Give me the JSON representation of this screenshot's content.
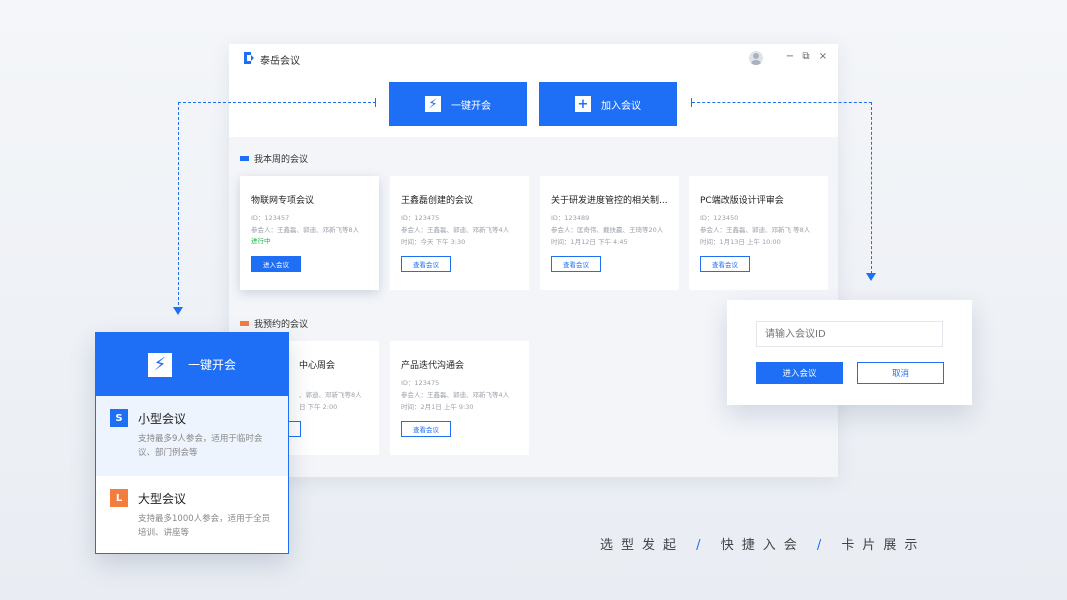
{
  "colors": {
    "accent": "#1e6ff5",
    "orange": "#f47c3c",
    "green": "#19b34c"
  },
  "app": {
    "title": "泰岳会议"
  },
  "window_controls": {
    "minimize": "−",
    "restore": "⧉",
    "close": "×"
  },
  "actions": {
    "quick_start": "一键开会",
    "join": "加入会议",
    "quick_icon": "⚡",
    "join_icon": "+"
  },
  "weekly": {
    "title": "我本周的会议",
    "cards": [
      {
        "title": "物联网专项会议",
        "id": "ID：123457",
        "members": "参会人：王鑫磊、郭迪、邓新飞等8人",
        "status": "进行中",
        "button": "进入会议"
      },
      {
        "title": "王鑫磊创建的会议",
        "id": "ID：123475",
        "members": "参会人：王鑫磊、郭迪、邓新飞等4人",
        "time": "时间：今天 下午 3:30",
        "button": "查看会议"
      },
      {
        "title": "关于研发进度管控的相关制...",
        "id": "ID：123489",
        "members": "参会人：匡奇伟、戴扶赢、王琦等20人",
        "time": "时间：1月12日 下午 4:45",
        "button": "查看会议"
      },
      {
        "title": "PC端改版设计评审会",
        "id": "ID：123450",
        "members": "参会人：王鑫磊、郭迪、邓新飞 等8人",
        "time": "时间：1月13日 上午 10:00",
        "button": "查看会议"
      }
    ]
  },
  "booked": {
    "title": "我预约的会议",
    "cards": [
      {
        "title": "中心周会",
        "members": "、郭迪、邓新飞等8人",
        "time": "日 下午 2:00"
      },
      {
        "title": "产品迭代沟通会",
        "id": "ID：123475",
        "members": "参会人：王鑫磊、郭迪、邓新飞等4人",
        "time": "时间：2月1日 上午 9:30",
        "button": "查看会议"
      }
    ]
  },
  "quick_menu": {
    "head": "一键开会",
    "options": [
      {
        "badge": "S",
        "title": "小型会议",
        "desc": "支持最多9人参会，适用于临时会议、部门例会等"
      },
      {
        "badge": "L",
        "title": "大型会议",
        "desc": "支持最多1000人参会，适用于全员培训、讲座等"
      }
    ]
  },
  "join_dialog": {
    "placeholder": "请输入会议ID",
    "confirm": "进入会议",
    "cancel": "取消"
  },
  "tagline": {
    "part1": "选型发起",
    "sep": "/",
    "part2": "快捷入会",
    "part3": "卡片展示"
  }
}
